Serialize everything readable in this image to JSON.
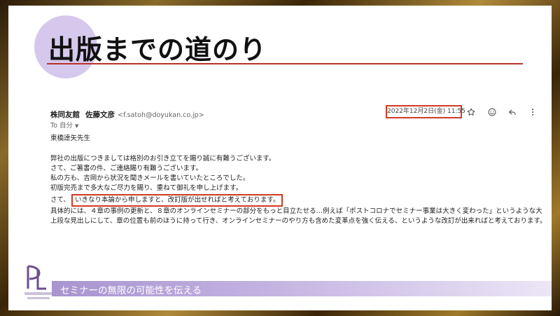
{
  "slide": {
    "title": "出版までの道のり",
    "banner_text": "セミナーの無限の可能性を伝える"
  },
  "email": {
    "sender_company": "株同友館",
    "sender_name": "佐藤文彦",
    "sender_email": "<f.satoh@doyukan.co.jp>",
    "to_label": "To 自分",
    "date": "2022年12月2日(金) 11:55",
    "greeting": "東橋達矢先生",
    "lines": [
      "弊社の出版につきましては格別のお引き立てを賜り誠に有難うございます。",
      "さて、ご著書の件、ご連絡賜り有難うございます。",
      "私の方も、吉岡から状況を聞きメールを書いていたところでした。",
      "初版完売まで多大なご尽力を賜り、重ねて御礼を申し上げます。"
    ],
    "line_prefix": "さて、",
    "highlight": "いきなり本論から申しますと、改訂版が出せればと考えております。",
    "paragraph": "具体的には、４章の事例の更新と、８章のオンラインセミナーの部分をもっと目立たせる…例えば「ポストコロナでセミナー事業は大きく変わった」というような大上段な見出しにして、章の位置も前のほうに持って行き、オンラインセミナーのやり方も含めた変革点を強く伝える、というような改訂が出来ればと考えております。"
  },
  "icons": {
    "star": "star-icon",
    "emoji": "emoji-icon",
    "reply": "reply-icon",
    "more": "more-vert-icon"
  },
  "colors": {
    "accent_red": "#d03a22",
    "title_rule": "#b8332a",
    "circle": "#d6c8ec",
    "banner": "#a894cf",
    "logo": "#6b4e8f"
  }
}
